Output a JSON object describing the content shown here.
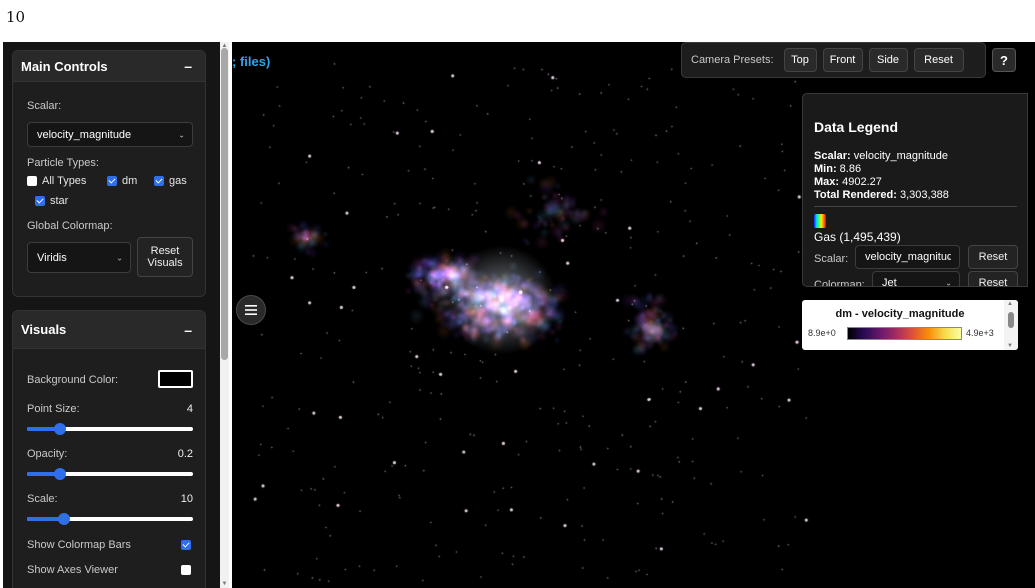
{
  "page_number": "10",
  "sidebar": {
    "main_controls": {
      "title": "Main Controls",
      "collapse": "–",
      "scalar_label": "Scalar:",
      "scalar_value": "velocity_magnitude",
      "particle_types_label": "Particle Types:",
      "types": [
        {
          "label": "All Types",
          "checked": false
        },
        {
          "label": "dm",
          "checked": true
        },
        {
          "label": "gas",
          "checked": true
        },
        {
          "label": "star",
          "checked": true
        }
      ],
      "global_colormap_label": "Global Colormap:",
      "global_colormap_value": "Viridis",
      "reset_visuals_label": "Reset Visuals"
    },
    "visuals": {
      "title": "Visuals",
      "collapse": "–",
      "background_color_label": "Background Color:",
      "background_color": "#000000",
      "point_size_label": "Point Size:",
      "point_size": "4",
      "point_size_fraction": 0.2,
      "opacity_label": "Opacity:",
      "opacity": "0.2",
      "opacity_fraction": 0.2,
      "scale_label": "Scale:",
      "scale": "10",
      "scale_fraction": 0.22,
      "show_colormap_bars_label": "Show Colormap Bars",
      "show_colormap_bars": true,
      "show_axes_viewer_label": "Show Axes Viewer",
      "show_axes_viewer": false
    }
  },
  "viewport": {
    "file_title": "; files)",
    "camera_presets_label": "Camera Presets:",
    "presets": [
      "Top",
      "Front",
      "Side",
      "Reset"
    ],
    "help_label": "?"
  },
  "legend": {
    "title": "Data Legend",
    "scalar_key": "Scalar:",
    "scalar_value": "velocity_magnitude",
    "min_key": "Min:",
    "min_value": "8.86",
    "max_key": "Max:",
    "max_value": "4902.27",
    "total_key": "Total Rendered:",
    "total_value": "3,303,388",
    "gas_title": "Gas (1,495,439)",
    "gas_scalar_label": "Scalar:",
    "gas_scalar_value": "velocity_magnitude",
    "gas_colormap_label": "Colormap:",
    "gas_colormap_value": "Jet",
    "reset_label": "Reset"
  },
  "colorbar": {
    "title": "dm - velocity_magnitude",
    "min_label": "8.9e+0",
    "max_label": "4.9e+3"
  },
  "colors": {
    "accent": "#2f6fea",
    "title_link": "#34a3e6",
    "panel_bg": "#1e1e1e"
  }
}
